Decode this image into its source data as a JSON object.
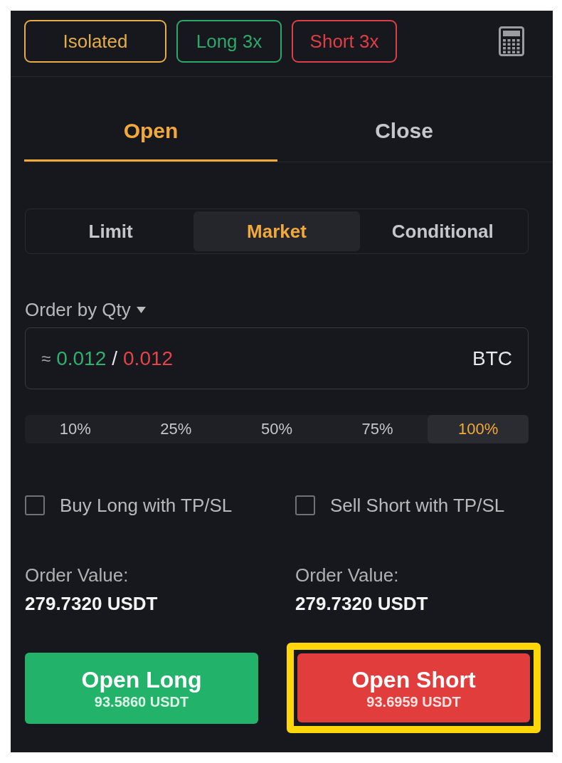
{
  "header": {
    "badges": [
      {
        "label": "Isolated",
        "color": "#e5ac4a"
      },
      {
        "label": "Long 3x",
        "color": "#2ea86a"
      },
      {
        "label": "Short 3x",
        "color": "#de3f47"
      }
    ]
  },
  "tabs": [
    {
      "label": "Open",
      "selected": true
    },
    {
      "label": "Close",
      "selected": false
    }
  ],
  "order_types": [
    {
      "label": "Limit",
      "selected": false
    },
    {
      "label": "Market",
      "selected": true
    },
    {
      "label": "Conditional",
      "selected": false
    }
  ],
  "quantity": {
    "mode_label": "Order by Qty",
    "approx_sign": "≈",
    "long_value": "0.012",
    "separator": "/",
    "short_value": "0.012",
    "unit": "BTC"
  },
  "percentages": [
    {
      "label": "10%",
      "selected": false
    },
    {
      "label": "25%",
      "selected": false
    },
    {
      "label": "50%",
      "selected": false
    },
    {
      "label": "75%",
      "selected": false
    },
    {
      "label": "100%",
      "selected": true
    }
  ],
  "tpsl_options": [
    {
      "label": "Buy Long with TP/SL",
      "checked": false
    },
    {
      "label": "Sell Short with TP/SL",
      "checked": false
    }
  ],
  "order_values": [
    {
      "label": "Order Value:",
      "value": "279.7320 USDT"
    },
    {
      "label": "Order Value:",
      "value": "279.7320 USDT"
    }
  ],
  "actions": [
    {
      "kind": "long",
      "label": "Open Long",
      "amount": "93.5860 USDT",
      "highlighted": false
    },
    {
      "kind": "short",
      "label": "Open Short",
      "amount": "93.6959 USDT",
      "highlighted": true
    }
  ]
}
